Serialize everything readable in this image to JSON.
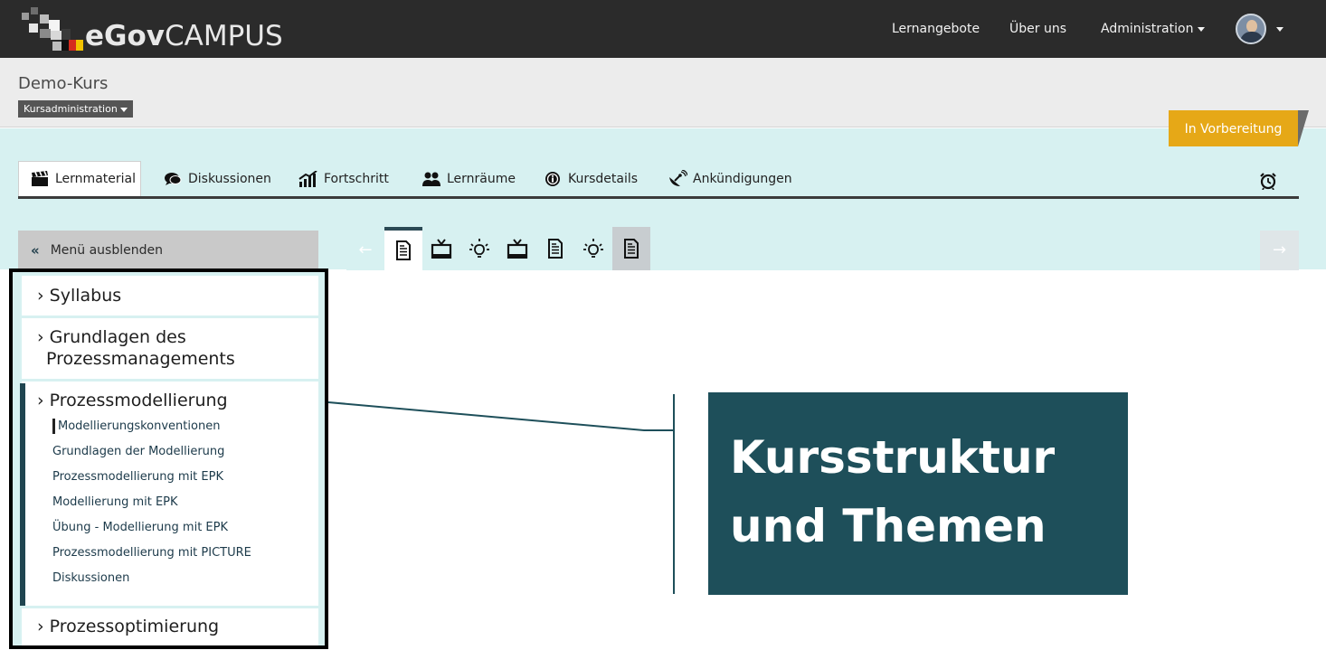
{
  "app": {
    "logo": {
      "text_e": "e",
      "text_gov": "Gov",
      "text_campus": "CAMPUS"
    },
    "nav": {
      "lernangebote": "Lernangebote",
      "ueber_uns": "Über uns",
      "administration": "Administration"
    },
    "user": {
      "avatar_icon": "user-avatar-icon"
    }
  },
  "course": {
    "title": "Demo-Kurs",
    "admin_dropdown": "Kursadministration",
    "status": "In Vorbereitung",
    "status_color": "#e6a817"
  },
  "tabs": [
    {
      "label": "Lernmaterial",
      "icon": "clapperboard-icon",
      "active": true
    },
    {
      "label": "Diskussionen",
      "icon": "speech-bubble-icon",
      "active": false
    },
    {
      "label": "Fortschritt",
      "icon": "chart-icon",
      "active": false
    },
    {
      "label": "Lernräume",
      "icon": "people-icon",
      "active": false
    },
    {
      "label": "Kursdetails",
      "icon": "info-icon",
      "active": false
    },
    {
      "label": "Ankündigungen",
      "icon": "satellite-icon",
      "active": false
    }
  ],
  "menu": {
    "toggle_label": "Menü ausblenden",
    "toggle_icon": "«",
    "sections": [
      {
        "title": "› Syllabus"
      },
      {
        "title": "› Grundlagen des",
        "title_line2": "Prozessmanagements"
      },
      {
        "title": "› Prozessmodellierung",
        "subitems": [
          "Modellierungskonventionen",
          "Grundlagen der Modellierung",
          "Prozessmodellierung mit EPK",
          "Modellierung mit EPK",
          "Übung - Modellierung mit EPK",
          "Prozessmodellierung mit PICTURE",
          "Diskussionen"
        ]
      },
      {
        "title": "› Prozessoptimierung"
      }
    ]
  },
  "units": [
    "document-icon",
    "tv-icon",
    "lightbulb-icon",
    "tv-icon",
    "document-icon",
    "lightbulb-icon",
    "document-icon"
  ],
  "nav_prev": "←",
  "nav_next": "→",
  "annotation": {
    "line1": "Kursstruktur",
    "line2": "und Themen",
    "background": "#1e4f5a"
  }
}
